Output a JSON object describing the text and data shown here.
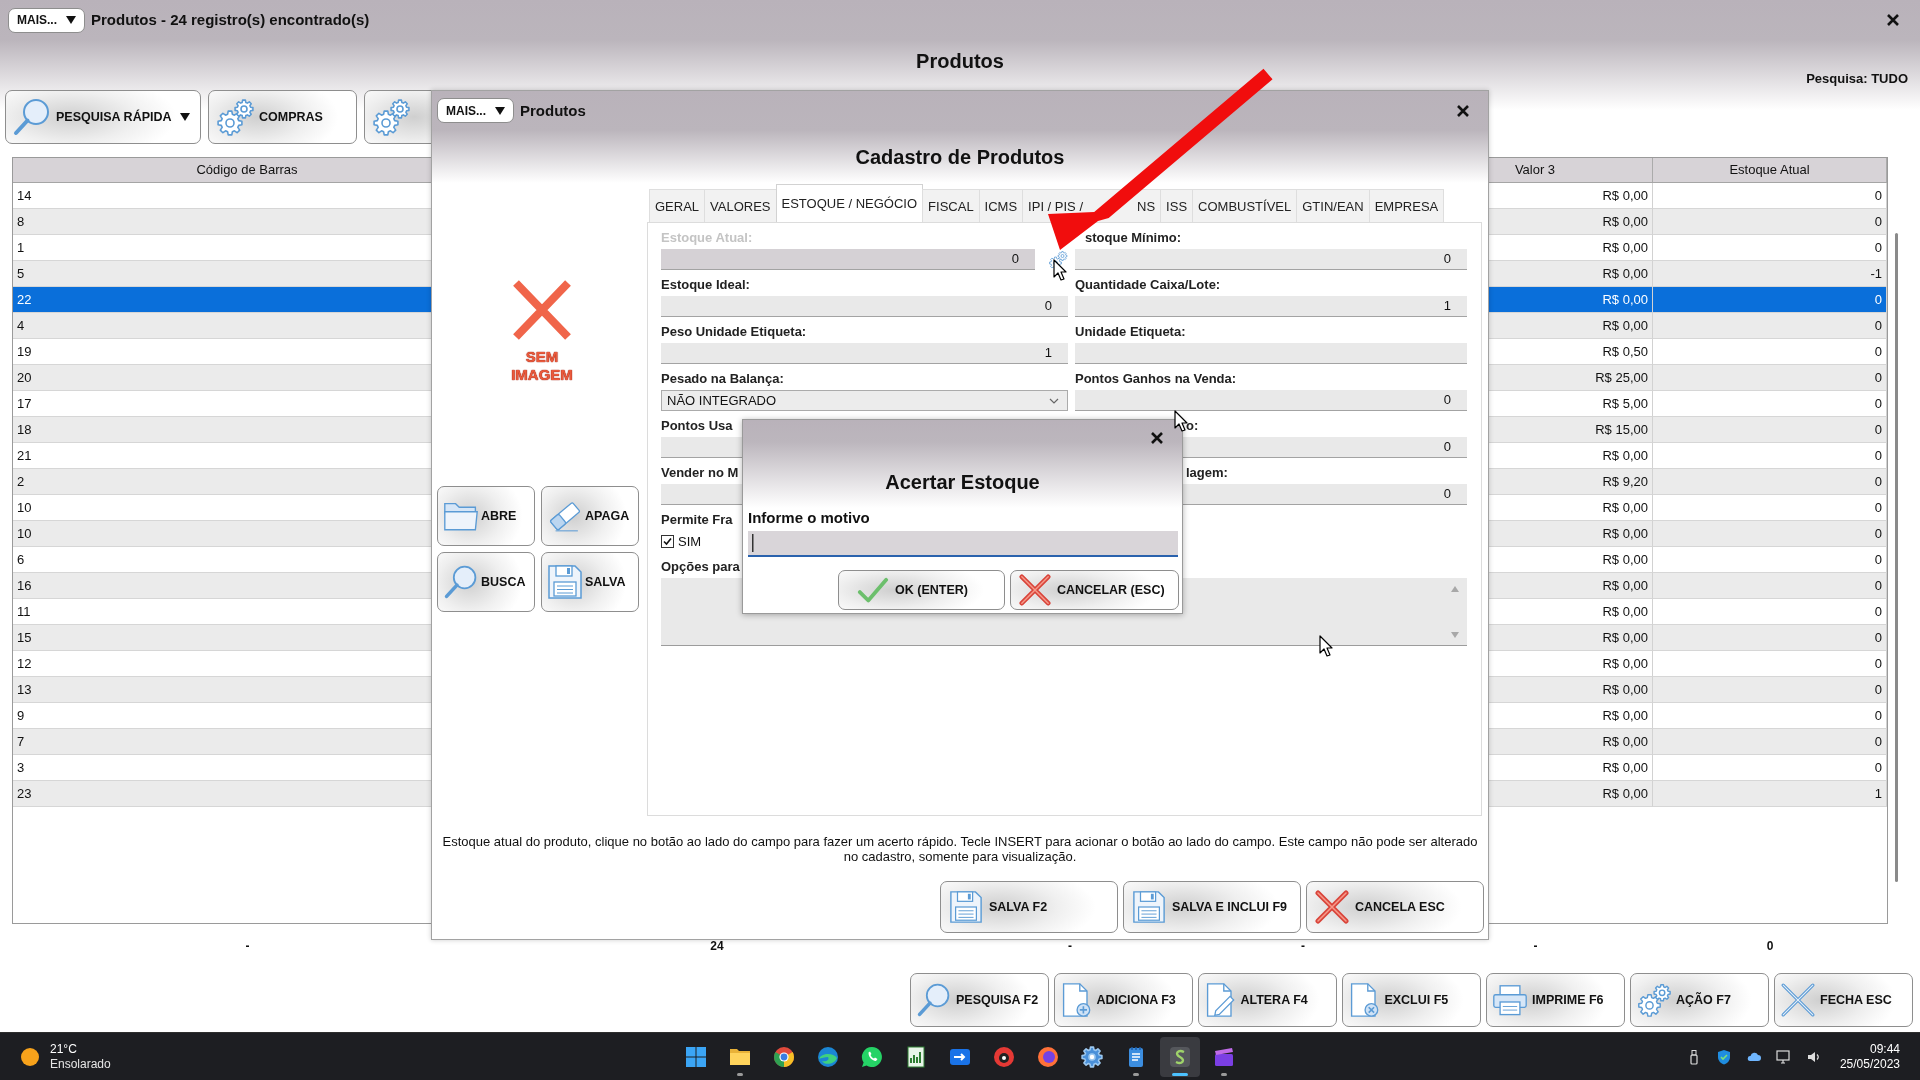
{
  "window": {
    "menu_button": "MAIS...",
    "title": "Produtos - 24 registro(s) encontrado(s)"
  },
  "header": {
    "title": "Produtos",
    "search_scope": "Pesquisa: TUDO"
  },
  "toolbar": [
    {
      "label": "PESQUISA RÁPIDA",
      "dropdown": true
    },
    {
      "label": "COMPRAS",
      "dropdown": false
    },
    {
      "dropdown": false
    }
  ],
  "table": {
    "columns": [
      "Código de Barras",
      "Valor 3",
      "Estoque Atual"
    ],
    "rows": [
      {
        "cells": [
          "14",
          "R$ 0,00",
          "0"
        ],
        "selected": false
      },
      {
        "cells": [
          "8",
          "R$ 0,00",
          "0"
        ],
        "selected": false
      },
      {
        "cells": [
          "1",
          "R$ 0,00",
          "0"
        ],
        "selected": false
      },
      {
        "cells": [
          "5",
          "R$ 0,00",
          "-1"
        ],
        "selected": false
      },
      {
        "cells": [
          "22",
          "R$ 0,00",
          "0"
        ],
        "selected": true
      },
      {
        "cells": [
          "4",
          "R$ 0,00",
          "0"
        ],
        "selected": false
      },
      {
        "cells": [
          "19",
          "R$ 0,50",
          "0"
        ],
        "selected": false
      },
      {
        "cells": [
          "20",
          "R$ 25,00",
          "0"
        ],
        "selected": false
      },
      {
        "cells": [
          "17",
          "R$ 5,00",
          "0"
        ],
        "selected": false
      },
      {
        "cells": [
          "18",
          "R$ 15,00",
          "0"
        ],
        "selected": false
      },
      {
        "cells": [
          "21",
          "R$ 0,00",
          "0"
        ],
        "selected": false
      },
      {
        "cells": [
          "2",
          "R$ 9,20",
          "0"
        ],
        "selected": false
      },
      {
        "cells": [
          "10",
          "R$ 0,00",
          "0"
        ],
        "selected": false
      },
      {
        "cells": [
          "10",
          "R$ 0,00",
          "0"
        ],
        "selected": false
      },
      {
        "cells": [
          "6",
          "R$ 0,00",
          "0"
        ],
        "selected": false
      },
      {
        "cells": [
          "16",
          "R$ 0,00",
          "0"
        ],
        "selected": false
      },
      {
        "cells": [
          "11",
          "R$ 0,00",
          "0"
        ],
        "selected": false
      },
      {
        "cells": [
          "15",
          "R$ 0,00",
          "0"
        ],
        "selected": false
      },
      {
        "cells": [
          "12",
          "R$ 0,00",
          "0"
        ],
        "selected": false
      },
      {
        "cells": [
          "13",
          "R$ 0,00",
          "0"
        ],
        "selected": false
      },
      {
        "cells": [
          "9",
          "R$ 0,00",
          "0"
        ],
        "selected": false
      },
      {
        "cells": [
          "7",
          "R$ 0,00",
          "0"
        ],
        "selected": false
      },
      {
        "cells": [
          "3",
          "R$ 0,00",
          "0"
        ],
        "selected": false
      },
      {
        "cells": [
          "23",
          "R$ 0,00",
          "1"
        ],
        "selected": false
      }
    ],
    "totals": [
      "-",
      "24",
      "-",
      "-",
      "-",
      "0"
    ]
  },
  "actions": [
    "PESQUISA F2",
    "ADICIONA F3",
    "ALTERA F4",
    "EXCLUI F5",
    "IMPRIME F6",
    "AÇÃO F7",
    "FECHA ESC"
  ],
  "dialog": {
    "menu_button": "MAIS...",
    "title": "Produtos",
    "heading": "Cadastro de Produtos",
    "image_placeholder": "SEM IMAGEM",
    "image_buttons": [
      "ABRE",
      "APAGA",
      "BUSCA",
      "SALVA"
    ],
    "tabs": [
      {
        "label": "GERAL",
        "selected": false
      },
      {
        "label": "VALORES",
        "selected": false
      },
      {
        "label": "ESTOQUE / NEGÓCIO",
        "selected": true
      },
      {
        "label": "FISCAL",
        "selected": false
      },
      {
        "label": "ICMS",
        "selected": false
      },
      {
        "label": "IPI / PIS /",
        "label_tail": "NS",
        "selected": false
      },
      {
        "label": "ISS",
        "selected": false
      },
      {
        "label": "COMBUSTÍVEL",
        "selected": false
      },
      {
        "label": "GTIN/EAN",
        "selected": false
      },
      {
        "label": "EMPRESA",
        "selected": false
      }
    ],
    "fields": [
      {
        "kind": "number",
        "label": "Estoque Atual:",
        "value": "0",
        "disabled": true,
        "action": true
      },
      {
        "kind": "number",
        "label": "stoque Mínimo:",
        "value": "0",
        "disabled": false,
        "covered_by_arrow": true
      },
      {
        "kind": "number",
        "label": "Estoque Ideal:",
        "value": "0",
        "disabled": false
      },
      {
        "kind": "number",
        "label": "Quantidade Caixa/Lote:",
        "value": "1",
        "disabled": false
      },
      {
        "kind": "number",
        "label": "Peso Unidade Etiqueta:",
        "value": "1",
        "disabled": false
      },
      {
        "kind": "text",
        "label": "Unidade Etiqueta:",
        "disabled": false
      },
      {
        "kind": "select",
        "label": "Pesado na Balança:",
        "value": "NÃO INTEGRADO",
        "disabled": false
      },
      {
        "kind": "number",
        "label": "Pontos Ganhos na Venda:",
        "value": "0",
        "disabled": false
      },
      {
        "kind": "text",
        "label": "Pontos Usa",
        "disabled": false
      },
      {
        "kind": "number",
        "label": "o:",
        "value": "0",
        "disabled": false,
        "covered_by_dialog": true
      },
      {
        "kind": "text",
        "label": "Vender no M",
        "disabled": false
      },
      {
        "kind": "number",
        "label": "lagem:",
        "value": "0",
        "disabled": false,
        "covered_by_dialog": true
      },
      {
        "kind": "checkbox",
        "label": "Permite Fra",
        "value": "SIM",
        "checked": true,
        "disabled": false
      },
      {
        "kind": "textarea",
        "label": "Opções para",
        "disabled": false
      }
    ],
    "help_text": "Estoque atual do produto, clique no botão ao lado do campo para fazer um acerto rápido. Tecle INSERT para acionar o botão ao lado do campo. Este campo não pode ser alterado no cadastro, somente para visualização.",
    "buttons": [
      "SALVA F2",
      "SALVA E INCLUI F9",
      "CANCELA ESC"
    ]
  },
  "modal": {
    "title": "Acertar Estoque",
    "label": "Informe o motivo",
    "buttons": [
      "OK (ENTER)",
      "CANCELAR (ESC)"
    ]
  },
  "taskbar": {
    "weather": {
      "temperature": "21°C",
      "condition": "Ensolarado"
    },
    "apps": [
      {
        "running": false,
        "active": false
      },
      {
        "running": true,
        "active": false
      },
      {
        "running": false,
        "active": false
      },
      {
        "running": false,
        "active": false
      },
      {
        "running": false,
        "active": false
      },
      {
        "running": false,
        "active": false
      },
      {
        "running": false,
        "active": false
      },
      {
        "running": false,
        "active": false
      },
      {
        "running": false,
        "active": false
      },
      {
        "running": false,
        "active": false
      },
      {
        "running": true,
        "active": false
      },
      {
        "running": true,
        "active": true
      },
      {
        "running": true,
        "active": false
      }
    ],
    "time": "09:44",
    "date": "25/05/2023"
  }
}
